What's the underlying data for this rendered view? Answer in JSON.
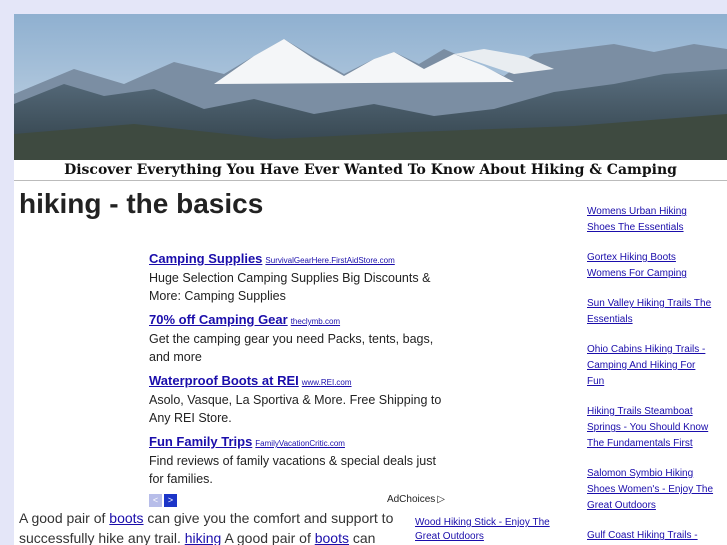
{
  "header": {
    "tagline": "Discover Everything You Have Ever Wanted To Know About Hiking & Camping"
  },
  "page_title": "hiking - the basics",
  "ads": [
    {
      "title": "Camping Supplies",
      "url": "SurvivalGearHere.FirstAidStore.com",
      "desc": "Huge Selection Camping Supplies Big Discounts & More: Camping Supplies"
    },
    {
      "title": "70% off Camping Gear",
      "url": "theclymb.com",
      "desc": "Get the camping gear you need Packs, tents, bags, and more"
    },
    {
      "title": "Waterproof Boots at REI",
      "url": "www.REI.com",
      "desc": "Asolo, Vasque, La Sportiva & More. Free Shipping to Any REI Store."
    },
    {
      "title": "Fun Family Trips",
      "url": "FamilyVacationCritic.com",
      "desc": "Find reviews of family vacations & special deals just for families."
    }
  ],
  "ad_footer": {
    "prev": "<",
    "next": ">",
    "adchoices": "AdChoices"
  },
  "body": {
    "t1": "A good pair of ",
    "link1": "boots",
    "t2": " can give you the comfort and support to successfully hike any trail. ",
    "link2": "hiking",
    "t3": " A good pair of ",
    "link3": "boots",
    "t4": " can"
  },
  "inner_links": [
    "Wood Hiking Stick - Enjoy The Great Outdoors"
  ],
  "sidebar": [
    "Womens Urban Hiking Shoes The Essentials",
    "Gortex Hiking Boots Womens For Camping",
    "Sun Valley Hiking Trails The Essentials",
    "Ohio Cabins Hiking Trails - Camping And Hiking For Fun",
    "Hiking Trails Steamboat Springs - You Should Know The Fundamentals First",
    "Salomon Symbio Hiking Shoes Women's - Enjoy The Great Outdoors",
    "Gulf Coast Hiking Trails -"
  ],
  "colors": {
    "link": "#1a0dab",
    "frame": "#e4e6f8",
    "nav_next": "#1c35c8",
    "nav_prev": "#b7bde9"
  }
}
